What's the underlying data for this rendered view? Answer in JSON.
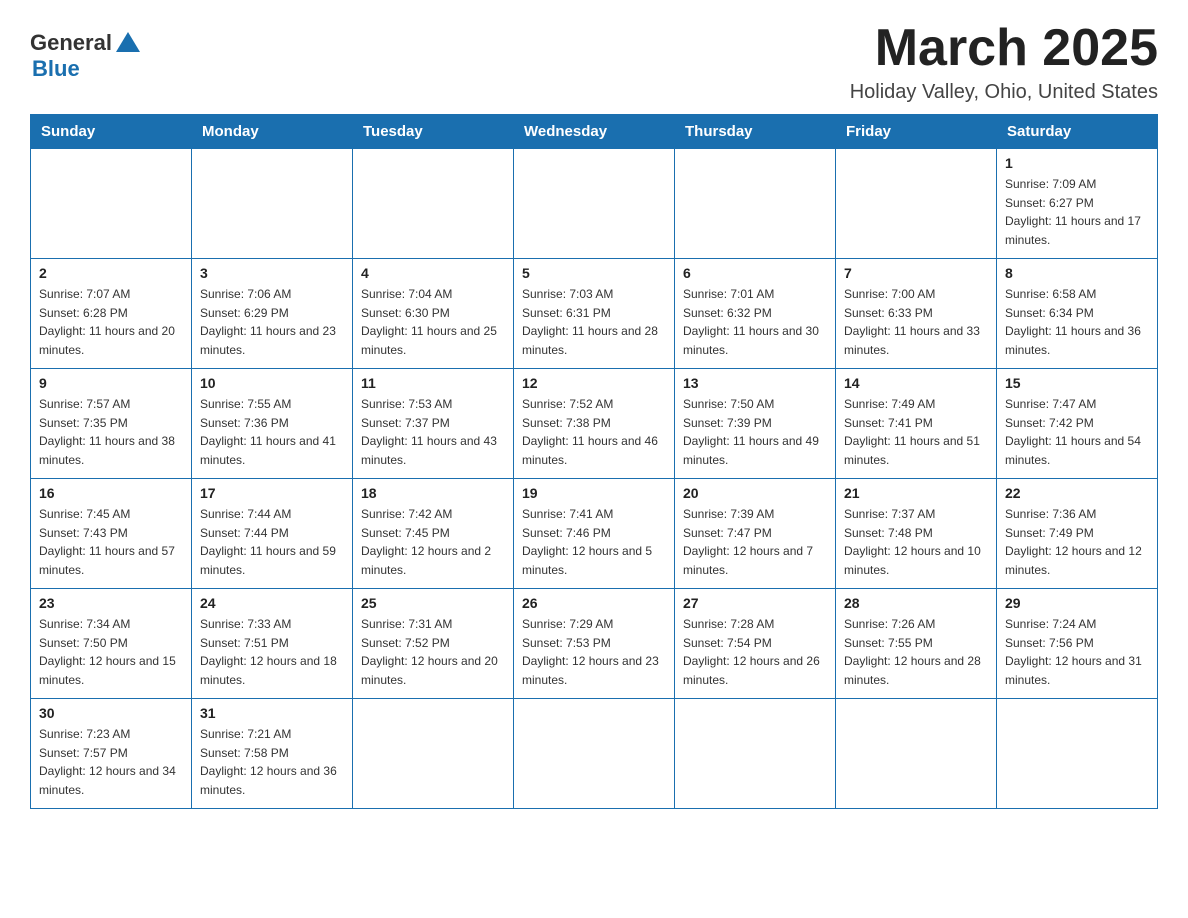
{
  "header": {
    "logo_general": "General",
    "logo_blue": "Blue",
    "month_title": "March 2025",
    "location": "Holiday Valley, Ohio, United States"
  },
  "days_of_week": [
    "Sunday",
    "Monday",
    "Tuesday",
    "Wednesday",
    "Thursday",
    "Friday",
    "Saturday"
  ],
  "weeks": [
    [
      {
        "day": "",
        "sunrise": "",
        "sunset": "",
        "daylight": ""
      },
      {
        "day": "",
        "sunrise": "",
        "sunset": "",
        "daylight": ""
      },
      {
        "day": "",
        "sunrise": "",
        "sunset": "",
        "daylight": ""
      },
      {
        "day": "",
        "sunrise": "",
        "sunset": "",
        "daylight": ""
      },
      {
        "day": "",
        "sunrise": "",
        "sunset": "",
        "daylight": ""
      },
      {
        "day": "",
        "sunrise": "",
        "sunset": "",
        "daylight": ""
      },
      {
        "day": "1",
        "sunrise": "Sunrise: 7:09 AM",
        "sunset": "Sunset: 6:27 PM",
        "daylight": "Daylight: 11 hours and 17 minutes."
      }
    ],
    [
      {
        "day": "2",
        "sunrise": "Sunrise: 7:07 AM",
        "sunset": "Sunset: 6:28 PM",
        "daylight": "Daylight: 11 hours and 20 minutes."
      },
      {
        "day": "3",
        "sunrise": "Sunrise: 7:06 AM",
        "sunset": "Sunset: 6:29 PM",
        "daylight": "Daylight: 11 hours and 23 minutes."
      },
      {
        "day": "4",
        "sunrise": "Sunrise: 7:04 AM",
        "sunset": "Sunset: 6:30 PM",
        "daylight": "Daylight: 11 hours and 25 minutes."
      },
      {
        "day": "5",
        "sunrise": "Sunrise: 7:03 AM",
        "sunset": "Sunset: 6:31 PM",
        "daylight": "Daylight: 11 hours and 28 minutes."
      },
      {
        "day": "6",
        "sunrise": "Sunrise: 7:01 AM",
        "sunset": "Sunset: 6:32 PM",
        "daylight": "Daylight: 11 hours and 30 minutes."
      },
      {
        "day": "7",
        "sunrise": "Sunrise: 7:00 AM",
        "sunset": "Sunset: 6:33 PM",
        "daylight": "Daylight: 11 hours and 33 minutes."
      },
      {
        "day": "8",
        "sunrise": "Sunrise: 6:58 AM",
        "sunset": "Sunset: 6:34 PM",
        "daylight": "Daylight: 11 hours and 36 minutes."
      }
    ],
    [
      {
        "day": "9",
        "sunrise": "Sunrise: 7:57 AM",
        "sunset": "Sunset: 7:35 PM",
        "daylight": "Daylight: 11 hours and 38 minutes."
      },
      {
        "day": "10",
        "sunrise": "Sunrise: 7:55 AM",
        "sunset": "Sunset: 7:36 PM",
        "daylight": "Daylight: 11 hours and 41 minutes."
      },
      {
        "day": "11",
        "sunrise": "Sunrise: 7:53 AM",
        "sunset": "Sunset: 7:37 PM",
        "daylight": "Daylight: 11 hours and 43 minutes."
      },
      {
        "day": "12",
        "sunrise": "Sunrise: 7:52 AM",
        "sunset": "Sunset: 7:38 PM",
        "daylight": "Daylight: 11 hours and 46 minutes."
      },
      {
        "day": "13",
        "sunrise": "Sunrise: 7:50 AM",
        "sunset": "Sunset: 7:39 PM",
        "daylight": "Daylight: 11 hours and 49 minutes."
      },
      {
        "day": "14",
        "sunrise": "Sunrise: 7:49 AM",
        "sunset": "Sunset: 7:41 PM",
        "daylight": "Daylight: 11 hours and 51 minutes."
      },
      {
        "day": "15",
        "sunrise": "Sunrise: 7:47 AM",
        "sunset": "Sunset: 7:42 PM",
        "daylight": "Daylight: 11 hours and 54 minutes."
      }
    ],
    [
      {
        "day": "16",
        "sunrise": "Sunrise: 7:45 AM",
        "sunset": "Sunset: 7:43 PM",
        "daylight": "Daylight: 11 hours and 57 minutes."
      },
      {
        "day": "17",
        "sunrise": "Sunrise: 7:44 AM",
        "sunset": "Sunset: 7:44 PM",
        "daylight": "Daylight: 11 hours and 59 minutes."
      },
      {
        "day": "18",
        "sunrise": "Sunrise: 7:42 AM",
        "sunset": "Sunset: 7:45 PM",
        "daylight": "Daylight: 12 hours and 2 minutes."
      },
      {
        "day": "19",
        "sunrise": "Sunrise: 7:41 AM",
        "sunset": "Sunset: 7:46 PM",
        "daylight": "Daylight: 12 hours and 5 minutes."
      },
      {
        "day": "20",
        "sunrise": "Sunrise: 7:39 AM",
        "sunset": "Sunset: 7:47 PM",
        "daylight": "Daylight: 12 hours and 7 minutes."
      },
      {
        "day": "21",
        "sunrise": "Sunrise: 7:37 AM",
        "sunset": "Sunset: 7:48 PM",
        "daylight": "Daylight: 12 hours and 10 minutes."
      },
      {
        "day": "22",
        "sunrise": "Sunrise: 7:36 AM",
        "sunset": "Sunset: 7:49 PM",
        "daylight": "Daylight: 12 hours and 12 minutes."
      }
    ],
    [
      {
        "day": "23",
        "sunrise": "Sunrise: 7:34 AM",
        "sunset": "Sunset: 7:50 PM",
        "daylight": "Daylight: 12 hours and 15 minutes."
      },
      {
        "day": "24",
        "sunrise": "Sunrise: 7:33 AM",
        "sunset": "Sunset: 7:51 PM",
        "daylight": "Daylight: 12 hours and 18 minutes."
      },
      {
        "day": "25",
        "sunrise": "Sunrise: 7:31 AM",
        "sunset": "Sunset: 7:52 PM",
        "daylight": "Daylight: 12 hours and 20 minutes."
      },
      {
        "day": "26",
        "sunrise": "Sunrise: 7:29 AM",
        "sunset": "Sunset: 7:53 PM",
        "daylight": "Daylight: 12 hours and 23 minutes."
      },
      {
        "day": "27",
        "sunrise": "Sunrise: 7:28 AM",
        "sunset": "Sunset: 7:54 PM",
        "daylight": "Daylight: 12 hours and 26 minutes."
      },
      {
        "day": "28",
        "sunrise": "Sunrise: 7:26 AM",
        "sunset": "Sunset: 7:55 PM",
        "daylight": "Daylight: 12 hours and 28 minutes."
      },
      {
        "day": "29",
        "sunrise": "Sunrise: 7:24 AM",
        "sunset": "Sunset: 7:56 PM",
        "daylight": "Daylight: 12 hours and 31 minutes."
      }
    ],
    [
      {
        "day": "30",
        "sunrise": "Sunrise: 7:23 AM",
        "sunset": "Sunset: 7:57 PM",
        "daylight": "Daylight: 12 hours and 34 minutes."
      },
      {
        "day": "31",
        "sunrise": "Sunrise: 7:21 AM",
        "sunset": "Sunset: 7:58 PM",
        "daylight": "Daylight: 12 hours and 36 minutes."
      },
      {
        "day": "",
        "sunrise": "",
        "sunset": "",
        "daylight": ""
      },
      {
        "day": "",
        "sunrise": "",
        "sunset": "",
        "daylight": ""
      },
      {
        "day": "",
        "sunrise": "",
        "sunset": "",
        "daylight": ""
      },
      {
        "day": "",
        "sunrise": "",
        "sunset": "",
        "daylight": ""
      },
      {
        "day": "",
        "sunrise": "",
        "sunset": "",
        "daylight": ""
      }
    ]
  ]
}
